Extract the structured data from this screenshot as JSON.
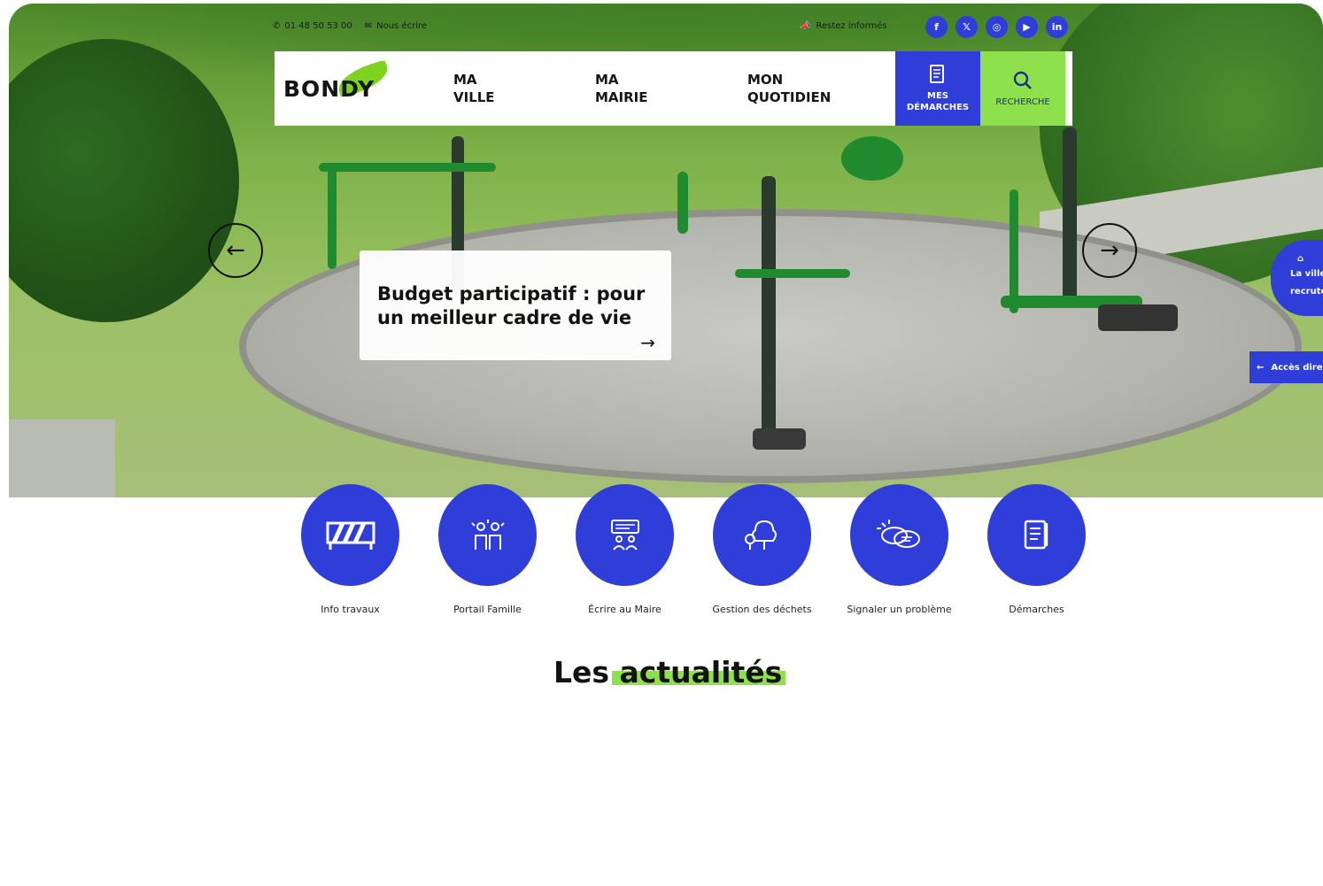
{
  "topbar": {
    "phone": "01 48 50 53 00",
    "write": "Nous écrire",
    "stay_informed": "Restez informés",
    "socials": [
      {
        "label": "f",
        "icon": "facebook-icon"
      },
      {
        "label": "𝕏",
        "icon": "x-twitter-icon"
      },
      {
        "label": "◎",
        "icon": "instagram-icon"
      },
      {
        "label": "▶",
        "icon": "youtube-icon"
      },
      {
        "label": "in",
        "icon": "linkedin-icon"
      }
    ]
  },
  "nav": {
    "logo": "BONDY",
    "items": [
      "MA\nVILLE",
      "MA\nMAIRIE",
      "MON\nQUOTIDIEN"
    ],
    "demarches_label": "MES\nDÉMARCHES",
    "search_label": "RECHERCHE"
  },
  "hero": {
    "title": "Budget participatif : pour un meilleur cadre de vie",
    "arrow": "→",
    "prev": "←",
    "next": "→"
  },
  "side": {
    "recrute": "La ville\nrecrute",
    "acces": "Accès directs",
    "acces_arrow": "←"
  },
  "quick_access": [
    {
      "label": "Info travaux",
      "icon": "roadblock-icon"
    },
    {
      "label": "Portail Famille",
      "icon": "family-icon"
    },
    {
      "label": "Écrire au Maire",
      "icon": "write-mayor-icon"
    },
    {
      "label": "Gestion des déchets",
      "icon": "waste-tree-icon"
    },
    {
      "label": "Signaler un problème",
      "icon": "report-chat-icon"
    },
    {
      "label": "Démarches",
      "icon": "document-icon"
    }
  ],
  "section": {
    "heading": "Les actualités"
  },
  "colors": {
    "brand_blue": "#2f3dd9",
    "brand_green": "#8fe04d"
  }
}
